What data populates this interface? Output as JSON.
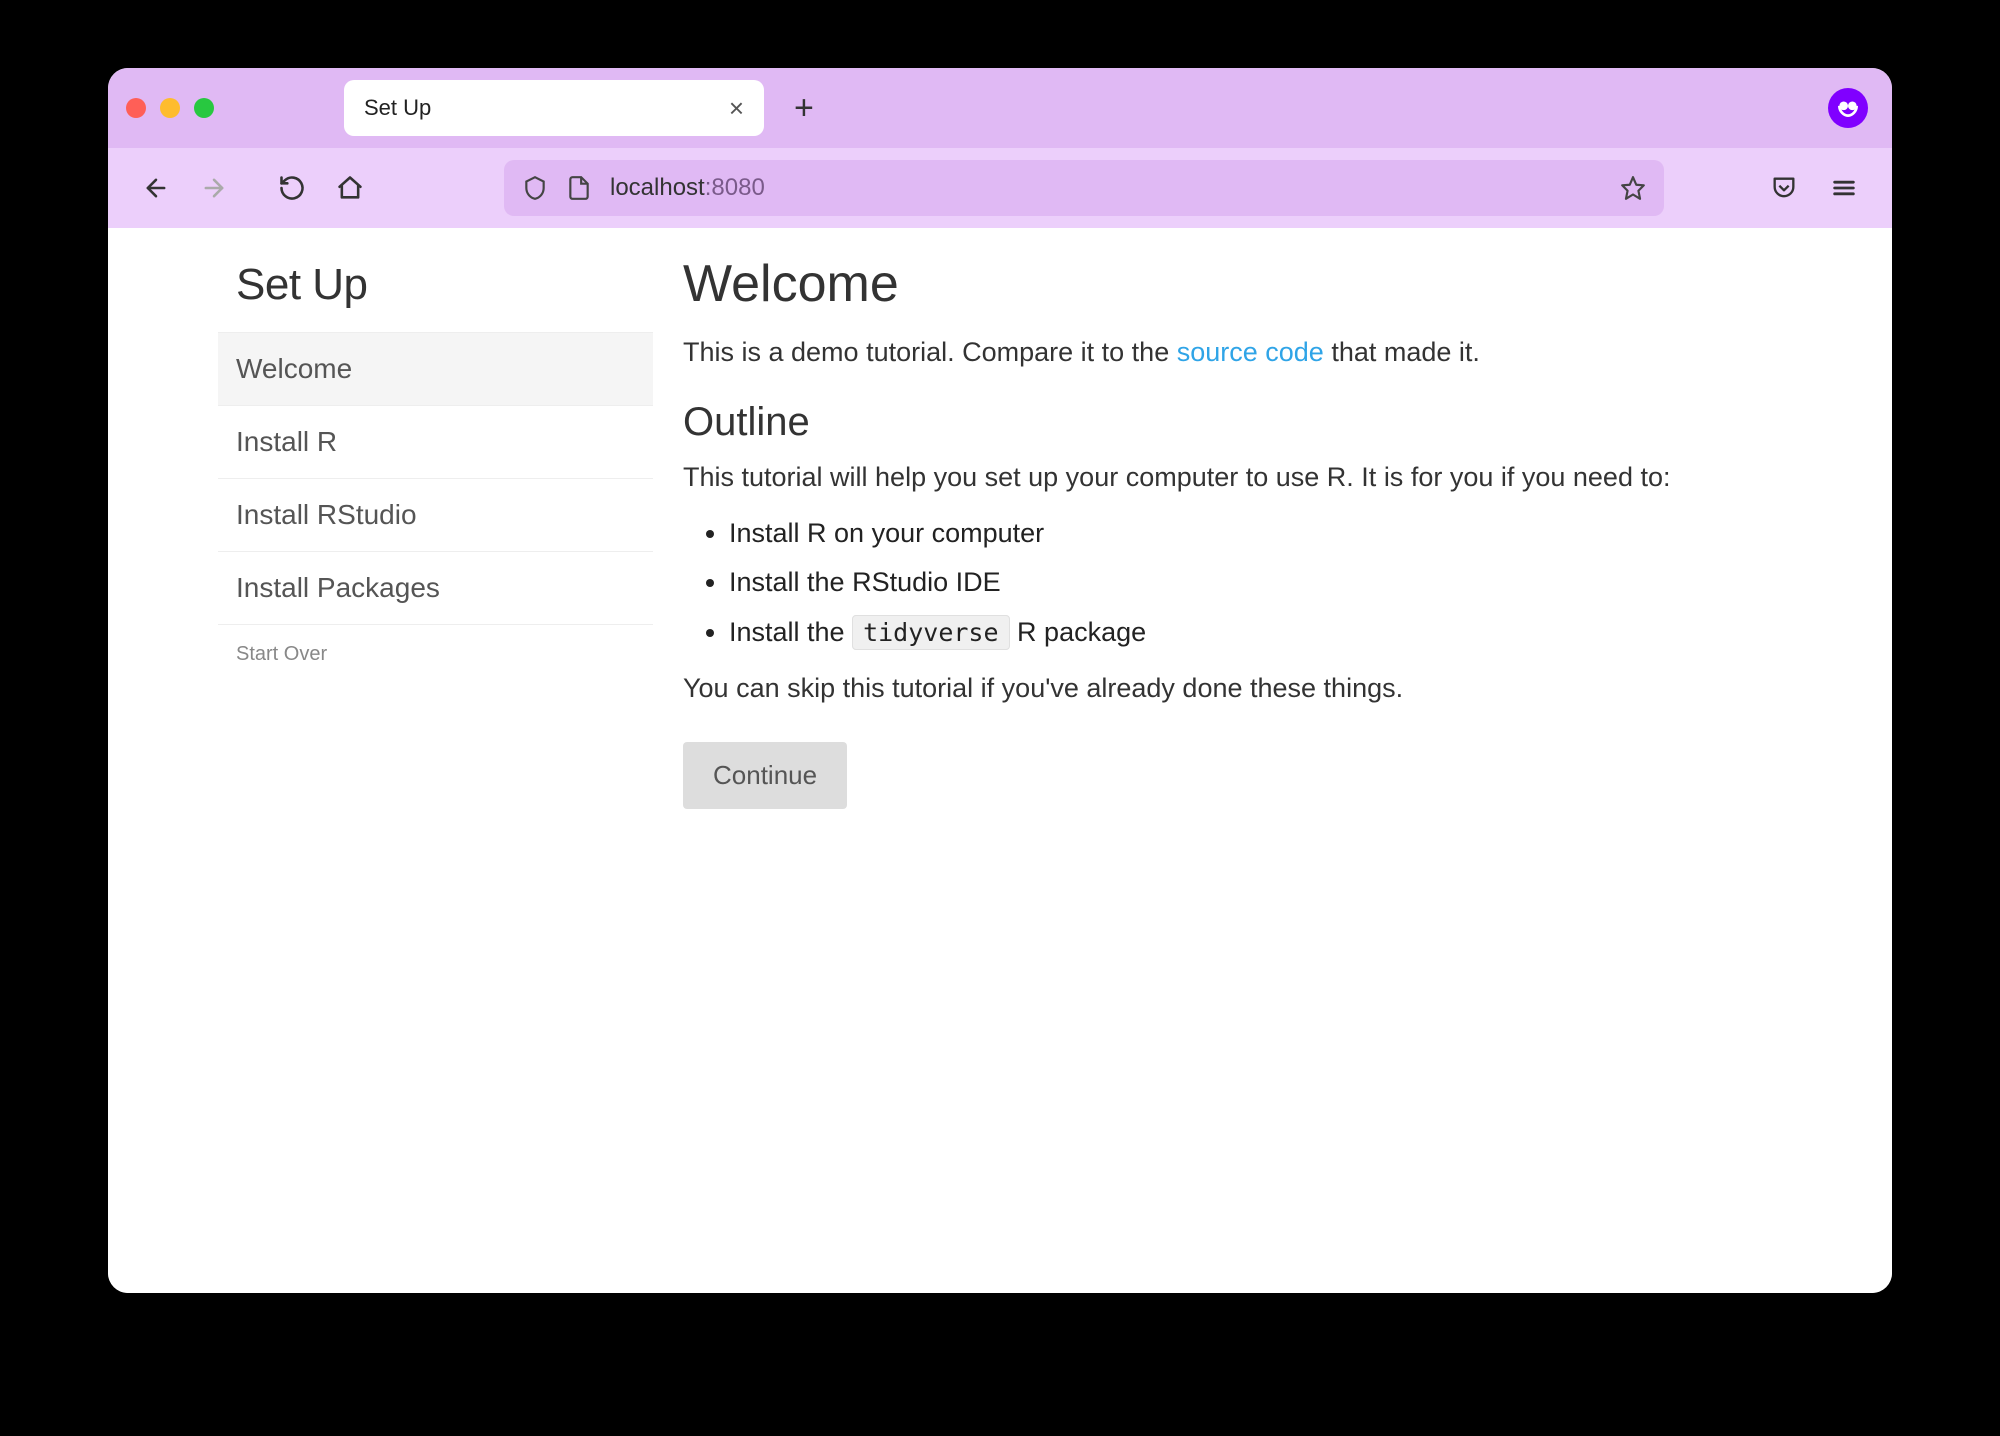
{
  "browser": {
    "tab_title": "Set Up",
    "url_host": "localhost",
    "url_port": ":8080"
  },
  "sidebar": {
    "title": "Set Up",
    "items": [
      {
        "label": "Welcome",
        "active": true
      },
      {
        "label": "Install R",
        "active": false
      },
      {
        "label": "Install RStudio",
        "active": false
      },
      {
        "label": "Install Packages",
        "active": false
      }
    ],
    "start_over": "Start Over"
  },
  "content": {
    "heading": "Welcome",
    "intro_before": "This is a demo tutorial. Compare it to the ",
    "intro_link": "source code",
    "intro_after": " that made it.",
    "outline_heading": "Outline",
    "outline_intro": "This tutorial will help you set up your computer to use R. It is for you if you need to:",
    "bullets": [
      "Install R on your computer",
      "Install the RStudio IDE"
    ],
    "bullet3_before": "Install the ",
    "bullet3_code": "tidyverse",
    "bullet3_after": " R package",
    "skip_text": "You can skip this tutorial if you've already done these things.",
    "continue_label": "Continue"
  }
}
